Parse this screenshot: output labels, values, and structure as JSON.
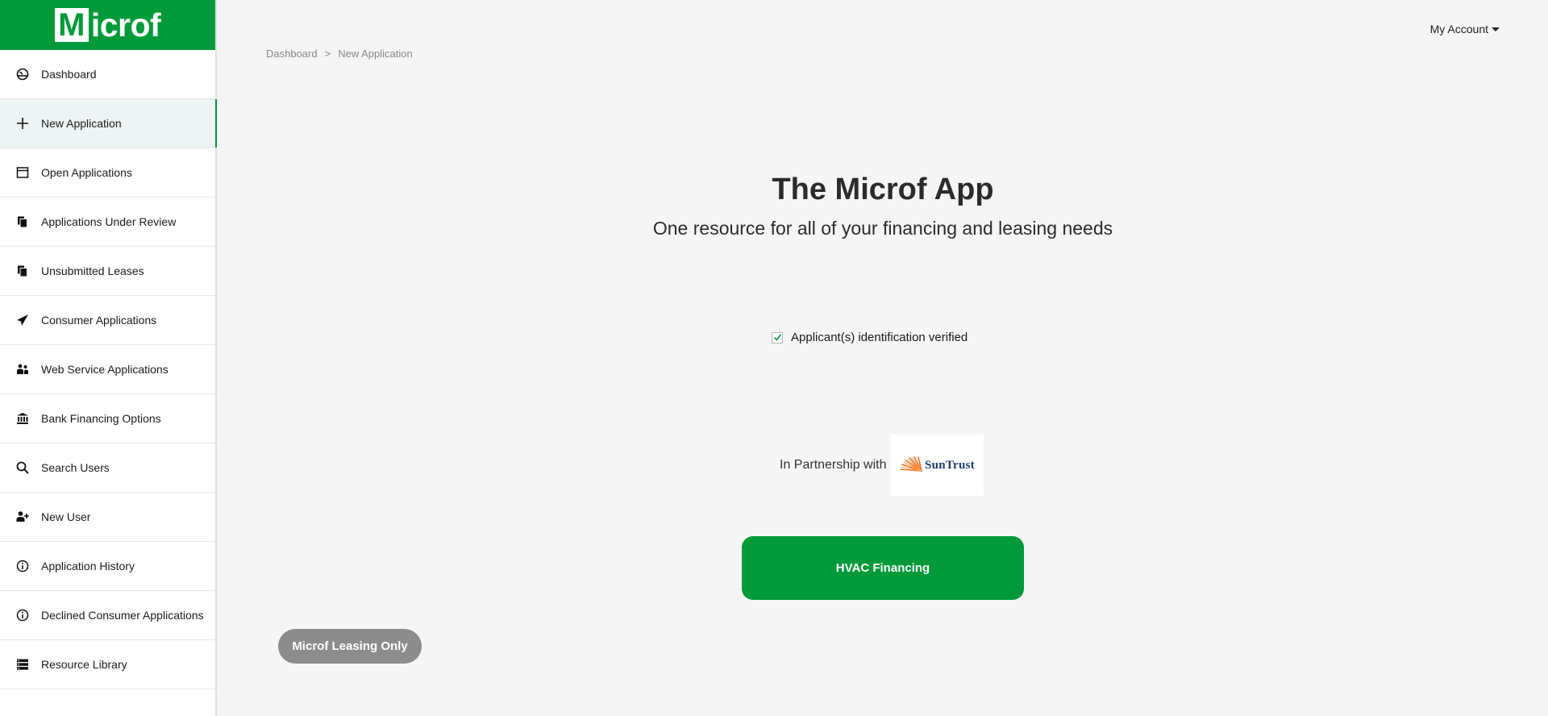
{
  "brand": {
    "logo_initial": "M",
    "logo_rest": "icrof",
    "color": "#009a3a"
  },
  "sidebar": {
    "items": [
      {
        "label": "Dashboard",
        "icon": "dashboard-gauge-icon"
      },
      {
        "label": "New Application",
        "icon": "plus-icon",
        "active": true
      },
      {
        "label": "Open Applications",
        "icon": "calendar-window-icon"
      },
      {
        "label": "Applications Under Review",
        "icon": "documents-icon"
      },
      {
        "label": "Unsubmitted Leases",
        "icon": "documents-icon"
      },
      {
        "label": "Consumer Applications",
        "icon": "paper-plane-icon"
      },
      {
        "label": "Web Service Applications",
        "icon": "users-group-icon"
      },
      {
        "label": "Bank Financing Options",
        "icon": "bank-icon"
      },
      {
        "label": "Search Users",
        "icon": "search-icon"
      },
      {
        "label": "New User",
        "icon": "add-user-icon"
      },
      {
        "label": "Application History",
        "icon": "info-circle-icon"
      },
      {
        "label": "Declined Consumer Applications",
        "icon": "info-circle-icon"
      },
      {
        "label": "Resource Library",
        "icon": "server-stack-icon"
      }
    ]
  },
  "breadcrumb": {
    "items": [
      "Dashboard",
      "New Application"
    ],
    "separator": ">"
  },
  "header": {
    "account_label": "My Account"
  },
  "main": {
    "title": "The Microf App",
    "subtitle": "One resource for all of your financing and leasing needs",
    "verification": {
      "label": "Applicant(s) identification verified",
      "checked": true
    },
    "partner": {
      "label": "In Partnership with",
      "logo_text": "SunTrust"
    },
    "primary_button": "HVAC Financing",
    "secondary_button": "Microf Leasing Only"
  },
  "colors": {
    "accent": "#009a3a",
    "secondary_button": "#8c8c8c",
    "background": "#f5f5f5",
    "suntrust_blue": "#1b3d6e",
    "suntrust_orange": "#f26f21"
  }
}
